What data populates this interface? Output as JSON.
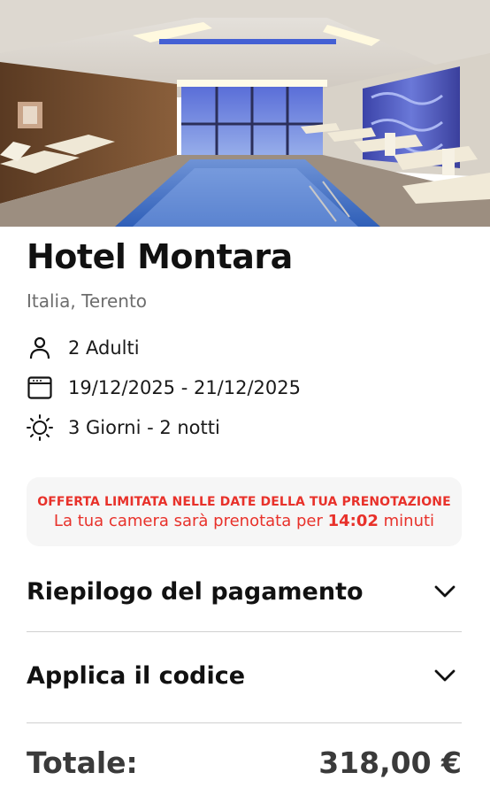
{
  "hotel": {
    "name": "Hotel Montara",
    "location": "Italia, Terento",
    "image_icon": "hotel-pool-photo"
  },
  "details": {
    "guests": {
      "icon": "user-icon",
      "text": "2 Adulti"
    },
    "dates": {
      "icon": "calendar-icon",
      "text": "19/12/2025 - 21/12/2025"
    },
    "duration": {
      "icon": "sun-icon",
      "text": "3 Giorni - 2 notti"
    }
  },
  "offer": {
    "title": "OFFERTA LIMITATA NELLE DATE DELLA TUA PRENOTAZIONE",
    "text_before": "La tua camera sarà prenotata per ",
    "time": "14:02",
    "text_after": " minuti",
    "color": "#e8312a"
  },
  "sections": {
    "payment_summary": {
      "label": "Riepilogo del pagamento",
      "icon": "chevron-down-icon"
    },
    "apply_code": {
      "label": "Applica il codice",
      "icon": "chevron-down-icon"
    }
  },
  "total": {
    "label": "Totale:",
    "value": "318,00 €"
  }
}
